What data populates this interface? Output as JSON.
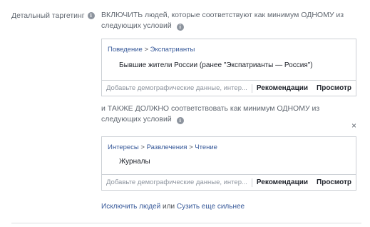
{
  "label": {
    "text": "Детальный таргетинг",
    "info": "i"
  },
  "first": {
    "heading": "ВКЛЮЧИТЬ людей, которые соответствуют как минимум ОДНОМУ из следующих условий",
    "info": "i",
    "breadcrumb_part1": "Поведение",
    "breadcrumb_sep": ">",
    "breadcrumb_part2": "Экспатрианты",
    "item": "Бывшие жители России (ранее \"Экспатрианты — Россия\")",
    "search_placeholder": "Добавьте демографические данные, интер...",
    "suggestions": "Рекомендации",
    "browse": "Просмотр"
  },
  "second": {
    "heading": "и ТАКЖЕ ДОЛЖНО соответствовать как минимум ОДНОМУ из следующих условий",
    "info": "i",
    "close": "×",
    "breadcrumb_part1": "Интересы",
    "breadcrumb_sep": ">",
    "breadcrumb_part2": "Развлечения",
    "breadcrumb_sep2": ">",
    "breadcrumb_part3": "Чтение",
    "item": "Журналы",
    "search_placeholder": "Добавьте демографические данные, интер...",
    "suggestions": "Рекомендации",
    "browse": "Просмотр"
  },
  "footer": {
    "exclude": "Исключить людей",
    "or": "или",
    "narrow": "Сузить еще сильнее"
  }
}
